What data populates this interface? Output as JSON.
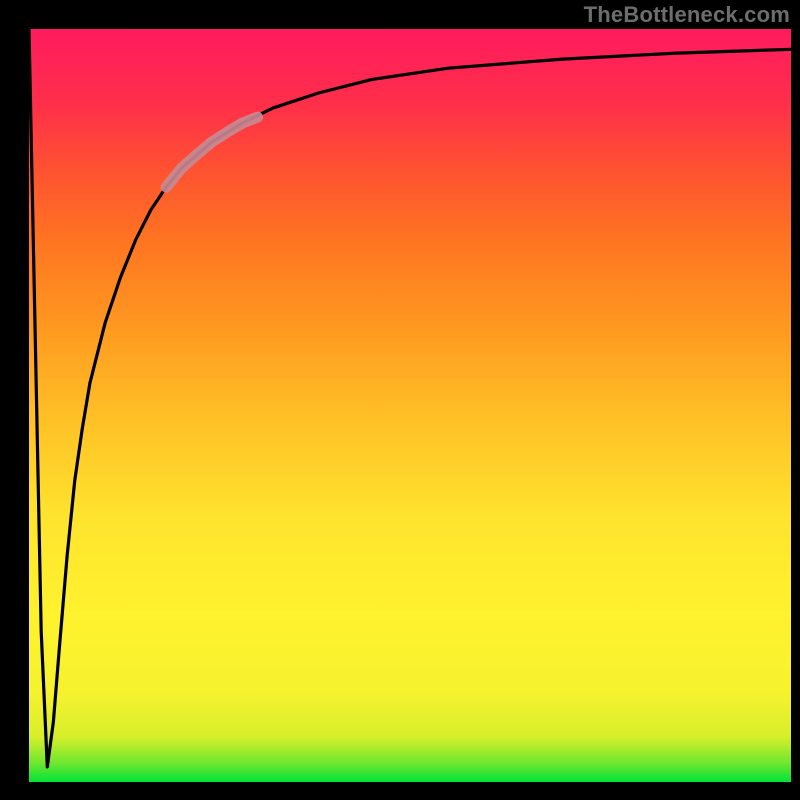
{
  "watermark": "TheBottleneck.com",
  "chart_data": {
    "type": "line",
    "title": "",
    "xlabel": "",
    "ylabel": "",
    "xlim": [
      0,
      100
    ],
    "ylim": [
      0,
      100
    ],
    "series": [
      {
        "name": "main-curve",
        "color": "#000000",
        "x": [
          0,
          0.8,
          1.6,
          2.4,
          3.2,
          4,
          5,
          6,
          7,
          8,
          10,
          12,
          14,
          16,
          18,
          20,
          24,
          28,
          32,
          38,
          45,
          55,
          70,
          85,
          100
        ],
        "y": [
          100,
          60,
          20,
          2,
          8,
          18,
          30,
          40,
          47,
          53,
          61,
          67,
          72,
          76,
          79,
          81.5,
          85,
          87.5,
          89.5,
          91.5,
          93.3,
          94.8,
          96,
          96.8,
          97.3
        ]
      },
      {
        "name": "highlight-segment",
        "color": "#c98a93",
        "x": [
          18,
          20,
          22,
          24,
          26,
          28,
          30
        ],
        "y": [
          79,
          81.5,
          83.3,
          85,
          86.3,
          87.5,
          88.3
        ]
      }
    ],
    "annotations": []
  },
  "colors": {
    "gradient_top": "#ff1b5e",
    "gradient_upper": "#ff6a22",
    "gradient_mid": "#ffe82e",
    "gradient_lower": "#b6ee2c",
    "gradient_bottom": "#00e338",
    "curve": "#000000",
    "highlight": "#c98a93",
    "frame": "#000000",
    "watermark": "#6d6d6d"
  }
}
